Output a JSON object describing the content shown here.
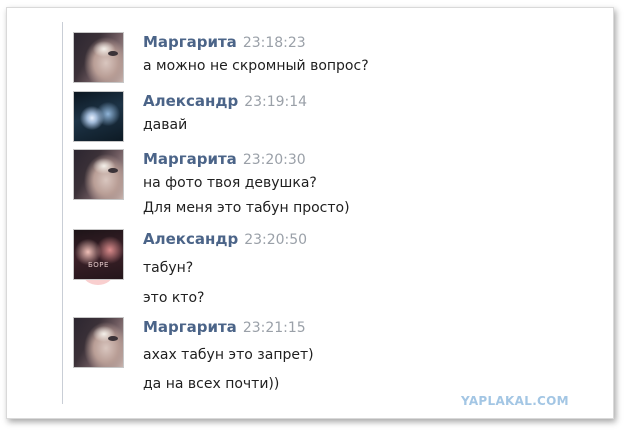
{
  "messages": [
    {
      "author": "Маргарита",
      "time": "23:18:23",
      "avatar": "girl-avatar",
      "lines": [
        "а можно не скромный вопрос?"
      ]
    },
    {
      "author": "Александр",
      "time": "23:19:14",
      "avatar": "night-photo-avatar",
      "lines": [
        "давай"
      ]
    },
    {
      "author": "Маргарита",
      "time": "23:20:30",
      "avatar": "girl-avatar",
      "lines": [
        "на фото твоя девушка?",
        "Для меня это табун просто)"
      ]
    },
    {
      "author": "Александр",
      "time": "23:20:50",
      "avatar": "couple-photo-avatar",
      "avatar_text": "БОРЕ",
      "lines": [
        "табун?",
        "это кто?"
      ]
    },
    {
      "author": "Маргарита",
      "time": "23:21:15",
      "avatar": "girl-avatar",
      "lines": [
        "ахах табун это запрет)",
        "да на всех почти))"
      ]
    }
  ],
  "watermark": "YAPLAKAL.COM",
  "colors": {
    "author_name": "#4b6488",
    "timestamp": "#9aa0a8",
    "message_text": "#1f1f1f",
    "watermark": "#a3c6e4"
  }
}
